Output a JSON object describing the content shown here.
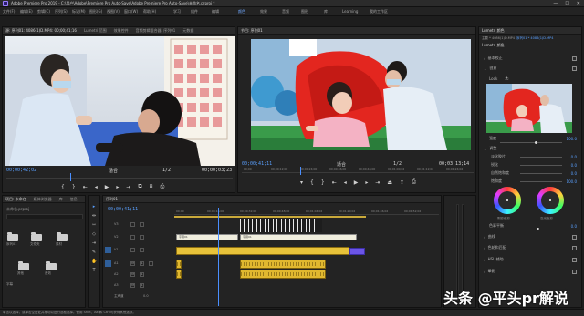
{
  "window": {
    "title": "Adobe Premiere Pro 2019 - C:\\用户\\Adobe\\Premiere Pro Auto-Save\\Adobe Premiere Pro Auto-Save\\未命名.prproj *",
    "controls": [
      "—",
      "☐",
      "✕"
    ]
  },
  "menu": {
    "items": [
      "文件(F)",
      "编辑(E)",
      "剪辑(C)",
      "序列(S)",
      "标记(M)",
      "图形(G)",
      "视图(V)",
      "窗口(W)",
      "帮助(H)"
    ],
    "workspaces": [
      "学习",
      "组件",
      "编辑",
      "颜色",
      "效果",
      "音频",
      "图形",
      "库",
      "Learning",
      "我的工作区"
    ],
    "active_workspace": "颜色"
  },
  "source_panel": {
    "tabs": [
      "源: 序列01: 4086(1)D.MP4: 00;00;41;16",
      "Lumetri 范围",
      "效果控件",
      "音频剪辑混合器: 序列01",
      "元数据"
    ],
    "timecode": "00;00;42;02",
    "duration": "00;00;03;23",
    "fit": "适合",
    "page": "1/2"
  },
  "program_panel": {
    "tabs": [
      "节目: 序列01"
    ],
    "timecode": "00;00;41;11",
    "duration": "00;03;13;14",
    "fit": "适合",
    "page": "1/2",
    "ruler_ticks": [
      "00;00",
      "00;00;12;00",
      "00;00;24;00",
      "00;00;36;00",
      "00;00;48;00",
      "00;01;00;02",
      "00;01;12;02",
      "00;01;24;02"
    ]
  },
  "project_panel": {
    "tabs": [
      "项目: 未命名",
      "媒体浏览器",
      "库",
      "信息"
    ],
    "project_name": "未命名.prproj",
    "items": [
      {
        "label": "序列01"
      },
      {
        "label": "文件夹"
      },
      {
        "label": "素材"
      },
      {
        "label": "其他"
      },
      {
        "label": "音效"
      },
      {
        "label": "字幕"
      }
    ]
  },
  "tools": [
    "▸",
    "⇹",
    "⇿",
    "◇",
    "⇥",
    "✎",
    "✋",
    "T"
  ],
  "timeline": {
    "tab": "序列01",
    "timecode": "00;00;41;11",
    "ruler_ticks": [
      "00;00",
      "00;00;16;00",
      "00;00;32;00",
      "00;00;48;00",
      "00;01;04;02",
      "00;01;20;02",
      "00;01;36;02",
      "00;01;52;02"
    ],
    "tracks": [
      {
        "name": "V3"
      },
      {
        "name": "V2"
      },
      {
        "name": "V1",
        "label": "视频 1"
      },
      {
        "name": "A1"
      },
      {
        "name": "A2",
        "label": "音频 2"
      },
      {
        "name": "A3"
      },
      {
        "name": "主声道",
        "value": "0.0"
      }
    ],
    "title_clip": "字幕01",
    "title_clip2": "字幕01"
  },
  "lumetri": {
    "header": "Lumetri 颜色",
    "clip": "主要 * 4086(1)D.MP4",
    "sequence": "序列01 * 4086(1)D.MP4",
    "effect": "Lumetri 颜色",
    "sections": {
      "basic": "基本校正",
      "creative": "创意",
      "curves": "曲线",
      "wheels": "色轮和匹配",
      "hsl": "HSL 辅助",
      "vignette": "晕影"
    },
    "look": "Look",
    "look_value": "无",
    "intensity_label": "强度",
    "intensity": "100.0",
    "adjustments_header": "调整",
    "sliders": [
      {
        "label": "淡化胶片",
        "value": "0.0"
      },
      {
        "label": "锐化",
        "value": "0.0"
      },
      {
        "label": "自然饱和度",
        "value": "0.0"
      },
      {
        "label": "饱和度",
        "value": "100.0"
      }
    ],
    "wheel_labels": {
      "shadow": "阴影色彩",
      "highlight": "高光色彩"
    },
    "tint_balance_label": "色彩平衡",
    "tint_balance": "0.0"
  },
  "status_bar": "单击以选择，或单击空白处并拖动以进行选框选择。使用 Shift、Alt 和 Ctrl 可获得其他选项。",
  "watermark": "头条 @平头pr解说"
}
